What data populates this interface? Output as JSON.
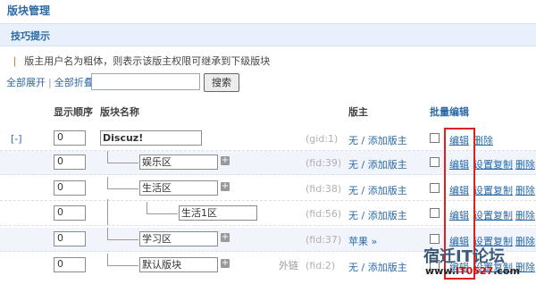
{
  "page": {
    "title": "版块管理"
  },
  "tips": {
    "title": "技巧提示",
    "text": "版主用户名为粗体，则表示该版主权限可继承到下级版块"
  },
  "toolbar": {
    "expand_all": "全部展开",
    "separator": "|",
    "collapse_all": "全部折叠",
    "search_button": "搜索"
  },
  "table": {
    "headers": {
      "order": "显示顺序",
      "name": "版块名称",
      "moderator": "版主",
      "batch_edit": "批量编辑"
    },
    "rows": [
      {
        "toggle": "[-]",
        "order": "0",
        "name": "Discuz!",
        "id": "(gid:1)",
        "moderator": "无 / 添加版主",
        "edit": "编辑",
        "copy": "",
        "delete": "删除"
      },
      {
        "order": "0",
        "name": "娱乐区",
        "id": "(fid:39)",
        "moderator": "无 / 添加版主",
        "edit": "编辑",
        "copy": "设置复制",
        "delete": "删除"
      },
      {
        "order": "0",
        "name": "生活区",
        "id": "(fid:38)",
        "moderator": "无 / 添加版主",
        "edit": "编辑",
        "copy": "设置复制",
        "delete": "删除"
      },
      {
        "order": "0",
        "name": "生活1区",
        "id": "(fid:56)",
        "moderator": "无 / 添加版主",
        "edit": "编辑",
        "copy": "设置复制",
        "delete": "删除"
      },
      {
        "order": "0",
        "name": "学习区",
        "id": "(fid:37)",
        "moderator": "苹果 »",
        "edit": "编辑",
        "copy": "设置复制",
        "delete": "删除"
      },
      {
        "order": "0",
        "name": "默认版块",
        "id": "(fid:2)",
        "extra": "外链",
        "moderator": "无 / 添加版主",
        "edit": "编辑",
        "copy": "设置复制",
        "delete": "删除"
      }
    ]
  },
  "watermark": {
    "line1": "宿迁IT论坛",
    "line2_prefix": "www.",
    "line2_brand": "IT0527",
    "line2_suffix": ".com"
  },
  "colors": {
    "link": "#2b6aa6",
    "highlight_box": "#e02020",
    "tips_bg": "#e8f1fb"
  }
}
